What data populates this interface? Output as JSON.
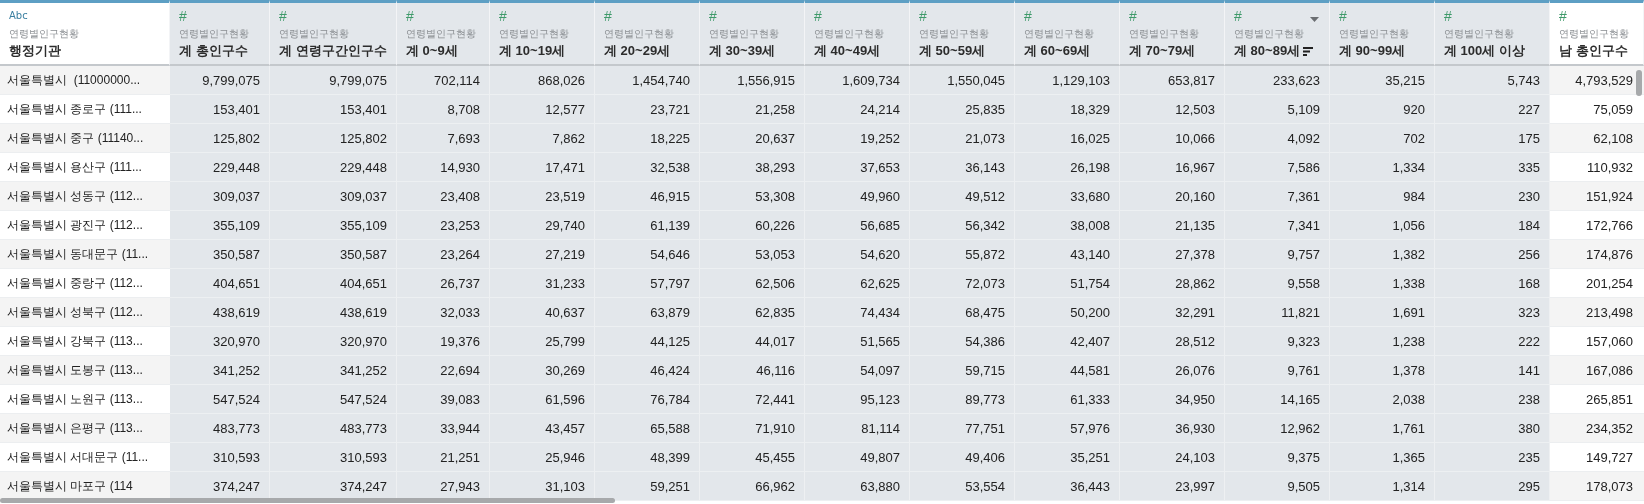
{
  "columns": [
    {
      "kind": "text",
      "type_label": "Abc",
      "source": "연령별인구현황",
      "title": "행정기관",
      "hovered": false,
      "sorted": false
    },
    {
      "kind": "number",
      "type_label": "#",
      "source": "연령별인구현황",
      "title": "계 총인구수",
      "hovered": false,
      "sorted": false
    },
    {
      "kind": "number",
      "type_label": "#",
      "source": "연령별인구현황",
      "title": "계 연령구간인구수",
      "hovered": false,
      "sorted": false
    },
    {
      "kind": "number",
      "type_label": "#",
      "source": "연령별인구현황",
      "title": "계 0~9세",
      "hovered": false,
      "sorted": false
    },
    {
      "kind": "number",
      "type_label": "#",
      "source": "연령별인구현황",
      "title": "계 10~19세",
      "hovered": false,
      "sorted": false
    },
    {
      "kind": "number",
      "type_label": "#",
      "source": "연령별인구현황",
      "title": "계 20~29세",
      "hovered": false,
      "sorted": false
    },
    {
      "kind": "number",
      "type_label": "#",
      "source": "연령별인구현황",
      "title": "계 30~39세",
      "hovered": false,
      "sorted": false
    },
    {
      "kind": "number",
      "type_label": "#",
      "source": "연령별인구현황",
      "title": "계 40~49세",
      "hovered": false,
      "sorted": false
    },
    {
      "kind": "number",
      "type_label": "#",
      "source": "연령별인구현황",
      "title": "계 50~59세",
      "hovered": false,
      "sorted": false
    },
    {
      "kind": "number",
      "type_label": "#",
      "source": "연령별인구현황",
      "title": "계 60~69세",
      "hovered": false,
      "sorted": false
    },
    {
      "kind": "number",
      "type_label": "#",
      "source": "연령별인구현황",
      "title": "계 70~79세",
      "hovered": false,
      "sorted": false
    },
    {
      "kind": "number",
      "type_label": "#",
      "source": "연령별인구현황",
      "title": "계 80~89세",
      "hovered": true,
      "sorted": true
    },
    {
      "kind": "number",
      "type_label": "#",
      "source": "연령별인구현황",
      "title": "계 90~99세",
      "hovered": false,
      "sorted": false
    },
    {
      "kind": "number",
      "type_label": "#",
      "source": "연령별인구현황",
      "title": "계 100세 이상",
      "hovered": false,
      "sorted": false
    },
    {
      "kind": "number",
      "type_label": "#",
      "source": "연령별인구현황",
      "title": "남 총인구수",
      "hovered": false,
      "sorted": false
    }
  ],
  "rows": [
    {
      "name": "서울특별시  (11000000...",
      "values": [
        "9,799,075",
        "9,799,075",
        "702,114",
        "868,026",
        "1,454,740",
        "1,556,915",
        "1,609,734",
        "1,550,045",
        "1,129,103",
        "653,817",
        "233,623",
        "35,215",
        "5,743",
        "4,793,529"
      ]
    },
    {
      "name": "서울특별시 종로구 (111...",
      "values": [
        "153,401",
        "153,401",
        "8,708",
        "12,577",
        "23,721",
        "21,258",
        "24,214",
        "25,835",
        "18,329",
        "12,503",
        "5,109",
        "920",
        "227",
        "75,059"
      ]
    },
    {
      "name": "서울특별시 중구 (11140...",
      "values": [
        "125,802",
        "125,802",
        "7,693",
        "7,862",
        "18,225",
        "20,637",
        "19,252",
        "21,073",
        "16,025",
        "10,066",
        "4,092",
        "702",
        "175",
        "62,108"
      ]
    },
    {
      "name": "서울특별시 용산구 (111...",
      "values": [
        "229,448",
        "229,448",
        "14,930",
        "17,471",
        "32,538",
        "38,293",
        "37,653",
        "36,143",
        "26,198",
        "16,967",
        "7,586",
        "1,334",
        "335",
        "110,932"
      ]
    },
    {
      "name": "서울특별시 성동구 (112...",
      "values": [
        "309,037",
        "309,037",
        "23,408",
        "23,519",
        "46,915",
        "53,308",
        "49,960",
        "49,512",
        "33,680",
        "20,160",
        "7,361",
        "984",
        "230",
        "151,924"
      ]
    },
    {
      "name": "서울특별시 광진구 (112...",
      "values": [
        "355,109",
        "355,109",
        "23,253",
        "29,740",
        "61,139",
        "60,226",
        "56,685",
        "56,342",
        "38,008",
        "21,135",
        "7,341",
        "1,056",
        "184",
        "172,766"
      ]
    },
    {
      "name": "서울특별시 동대문구 (11...",
      "values": [
        "350,587",
        "350,587",
        "23,264",
        "27,219",
        "54,646",
        "53,053",
        "54,620",
        "55,872",
        "43,140",
        "27,378",
        "9,757",
        "1,382",
        "256",
        "174,876"
      ]
    },
    {
      "name": "서울특별시 중랑구 (112...",
      "values": [
        "404,651",
        "404,651",
        "26,737",
        "31,233",
        "57,797",
        "62,506",
        "62,625",
        "72,073",
        "51,754",
        "28,862",
        "9,558",
        "1,338",
        "168",
        "201,254"
      ]
    },
    {
      "name": "서울특별시 성북구 (112...",
      "values": [
        "438,619",
        "438,619",
        "32,033",
        "40,637",
        "63,879",
        "62,835",
        "74,434",
        "68,475",
        "50,200",
        "32,291",
        "11,821",
        "1,691",
        "323",
        "213,498"
      ]
    },
    {
      "name": "서울특별시 강북구 (113...",
      "values": [
        "320,970",
        "320,970",
        "19,376",
        "25,799",
        "44,125",
        "44,017",
        "51,565",
        "54,386",
        "42,407",
        "28,512",
        "9,323",
        "1,238",
        "222",
        "157,060"
      ]
    },
    {
      "name": "서울특별시 도봉구 (113...",
      "values": [
        "341,252",
        "341,252",
        "22,694",
        "30,269",
        "46,424",
        "46,116",
        "54,097",
        "59,715",
        "44,581",
        "26,076",
        "9,761",
        "1,378",
        "141",
        "167,086"
      ]
    },
    {
      "name": "서울특별시 노원구 (113...",
      "values": [
        "547,524",
        "547,524",
        "39,083",
        "61,596",
        "76,784",
        "72,441",
        "95,123",
        "89,773",
        "61,333",
        "34,950",
        "14,165",
        "2,038",
        "238",
        "265,851"
      ]
    },
    {
      "name": "서울특별시 은평구 (113...",
      "values": [
        "483,773",
        "483,773",
        "33,944",
        "43,457",
        "65,588",
        "71,910",
        "81,114",
        "77,751",
        "57,976",
        "36,930",
        "12,962",
        "1,761",
        "380",
        "234,352"
      ]
    },
    {
      "name": "서울특별시 서대문구 (11...",
      "values": [
        "310,593",
        "310,593",
        "21,251",
        "25,946",
        "48,399",
        "45,455",
        "49,807",
        "49,406",
        "35,251",
        "24,103",
        "9,375",
        "1,365",
        "235",
        "149,727"
      ]
    },
    {
      "name": "서울특별시 마포구 (114",
      "values": [
        "374,247",
        "374,247",
        "27,943",
        "31,103",
        "59,251",
        "66,962",
        "63,880",
        "53,554",
        "36,443",
        "23,997",
        "9,505",
        "1,314",
        "295",
        "178,073"
      ]
    }
  ]
}
